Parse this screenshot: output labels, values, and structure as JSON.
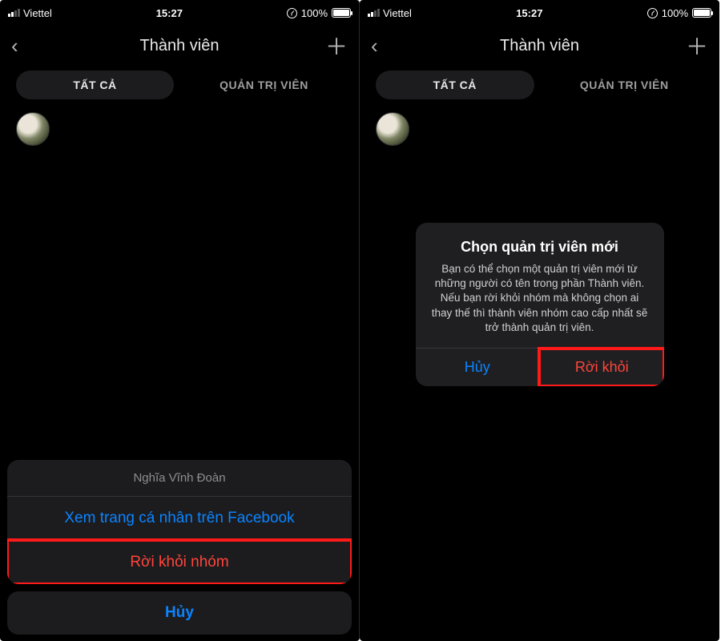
{
  "status": {
    "carrier": "Viettel",
    "time": "15:27",
    "battery_pct": "100%"
  },
  "nav": {
    "back_glyph": "‹",
    "title": "Thành viên",
    "add_glyph": "＋"
  },
  "tabs": {
    "all": "TẤT CẢ",
    "admins": "QUẢN TRỊ VIÊN"
  },
  "left": {
    "sheet_header": "Nghĩa Vĩnh Đoàn",
    "view_profile": "Xem trang cá nhân trên Facebook",
    "leave_group": "Rời khỏi nhóm",
    "cancel": "Hủy"
  },
  "right": {
    "alert_title": "Chọn quản trị viên mới",
    "alert_message": "Bạn có thể chọn một quản trị viên mới từ những người có tên trong phần Thành viên. Nếu bạn rời khỏi nhóm mà không chọn ai thay thế thì thành viên nhóm cao cấp nhất sẽ trở thành quản trị viên.",
    "alert_cancel": "Hủy",
    "alert_leave": "Rời khỏi"
  }
}
